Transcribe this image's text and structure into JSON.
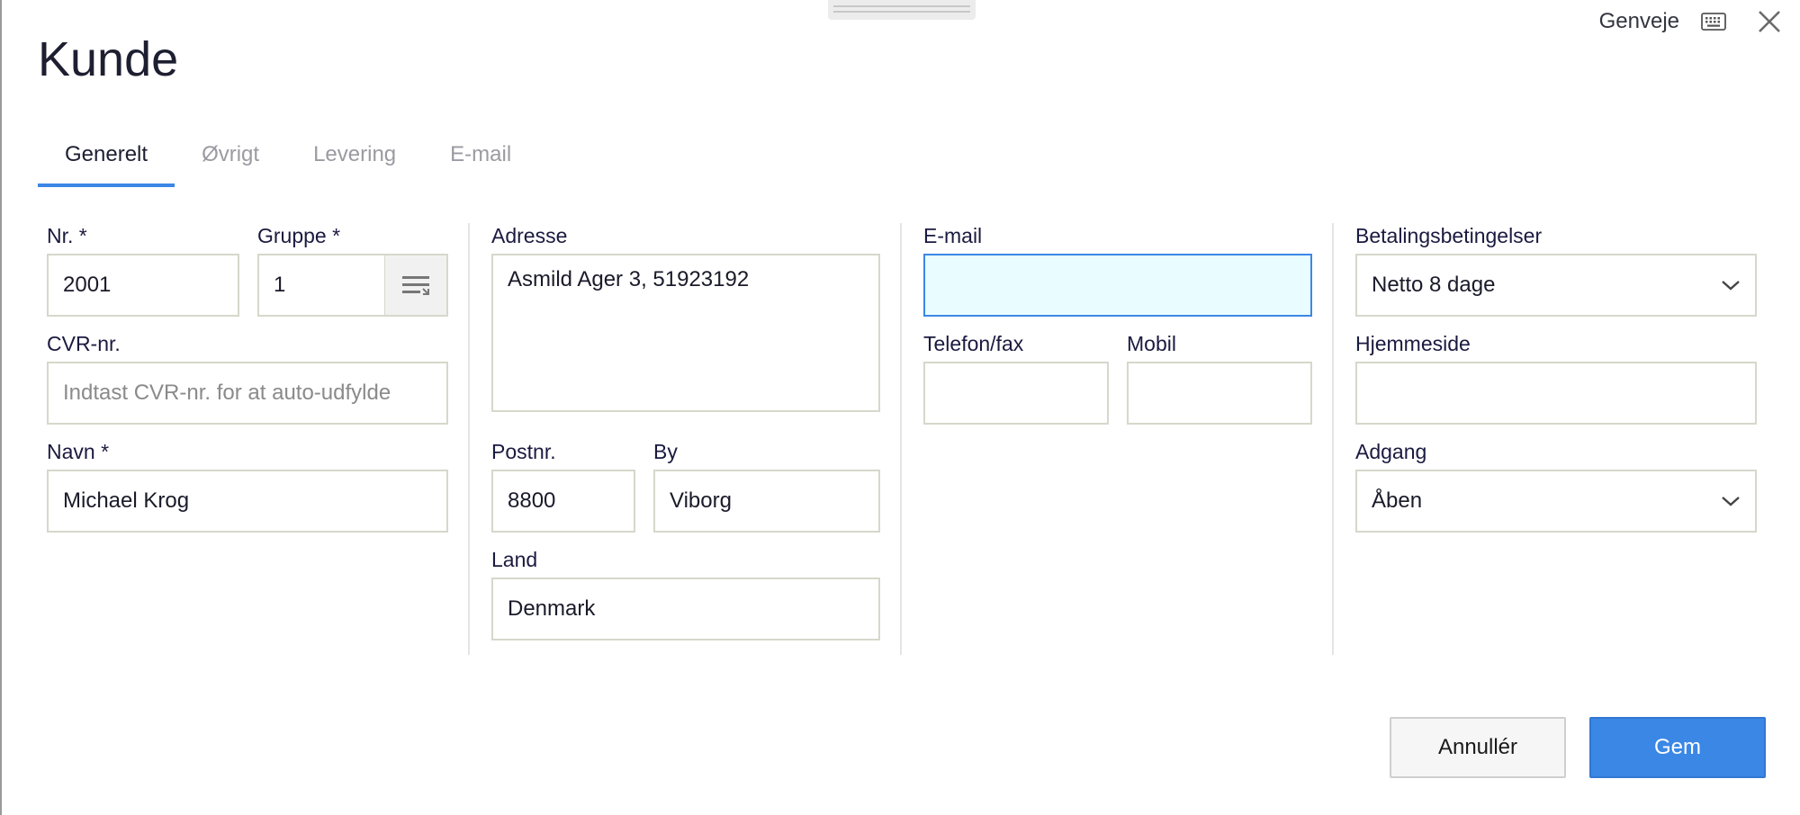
{
  "header": {
    "title": "Kunde",
    "shortcuts_label": "Genveje",
    "keyboard_icon": "keyboard-icon",
    "close_icon": "close-icon"
  },
  "tabs": [
    {
      "label": "Generelt",
      "active": true
    },
    {
      "label": "Øvrigt",
      "active": false
    },
    {
      "label": "Levering",
      "active": false
    },
    {
      "label": "E-mail",
      "active": false
    }
  ],
  "form": {
    "nr": {
      "label": "Nr. *",
      "value": "2001"
    },
    "gruppe": {
      "label": "Gruppe *",
      "value": "1",
      "lookup_icon": "list-lookup-icon"
    },
    "cvr": {
      "label": "CVR-nr.",
      "value": "",
      "placeholder": "Indtast CVR-nr. for at auto-udfylde"
    },
    "navn": {
      "label": "Navn *",
      "value": "Michael Krog"
    },
    "adresse": {
      "label": "Adresse",
      "value": "Asmild Ager 3, 51923192"
    },
    "postnr": {
      "label": "Postnr.",
      "value": "8800"
    },
    "by": {
      "label": "By",
      "value": "Viborg"
    },
    "land": {
      "label": "Land",
      "value": "Denmark"
    },
    "email": {
      "label": "E-mail",
      "value": ""
    },
    "telefon": {
      "label": "Telefon/fax",
      "value": ""
    },
    "mobil": {
      "label": "Mobil",
      "value": ""
    },
    "betaling": {
      "label": "Betalingsbetingelser",
      "value": "Netto 8 dage"
    },
    "hjemmeside": {
      "label": "Hjemmeside",
      "value": ""
    },
    "adgang": {
      "label": "Adgang",
      "value": "Åben"
    }
  },
  "footer": {
    "cancel_label": "Annullér",
    "save_label": "Gem"
  },
  "colors": {
    "accent": "#3b87e6",
    "focused_field_bg": "#e9fcff",
    "field_border": "#d7d7cb"
  }
}
